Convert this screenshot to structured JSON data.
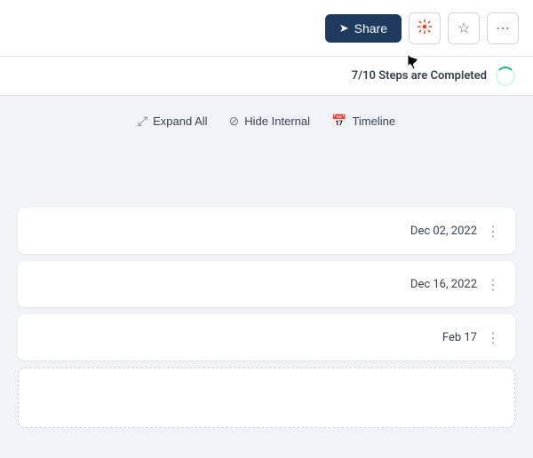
{
  "header": {
    "share_label": "Share",
    "hubspot_icon": "⚙",
    "star_icon": "☆",
    "more_icon": "⋯"
  },
  "steps": {
    "completed": 7,
    "total": 10,
    "label": "Steps are Completed"
  },
  "toolbar": {
    "expand_all": "Expand All",
    "hide_internal": "Hide Internal",
    "timeline": "Timeline"
  },
  "cards": [
    {
      "date": "Dec 02, 2022"
    },
    {
      "date": "Dec 16, 2022"
    },
    {
      "date": "Feb 17"
    }
  ]
}
